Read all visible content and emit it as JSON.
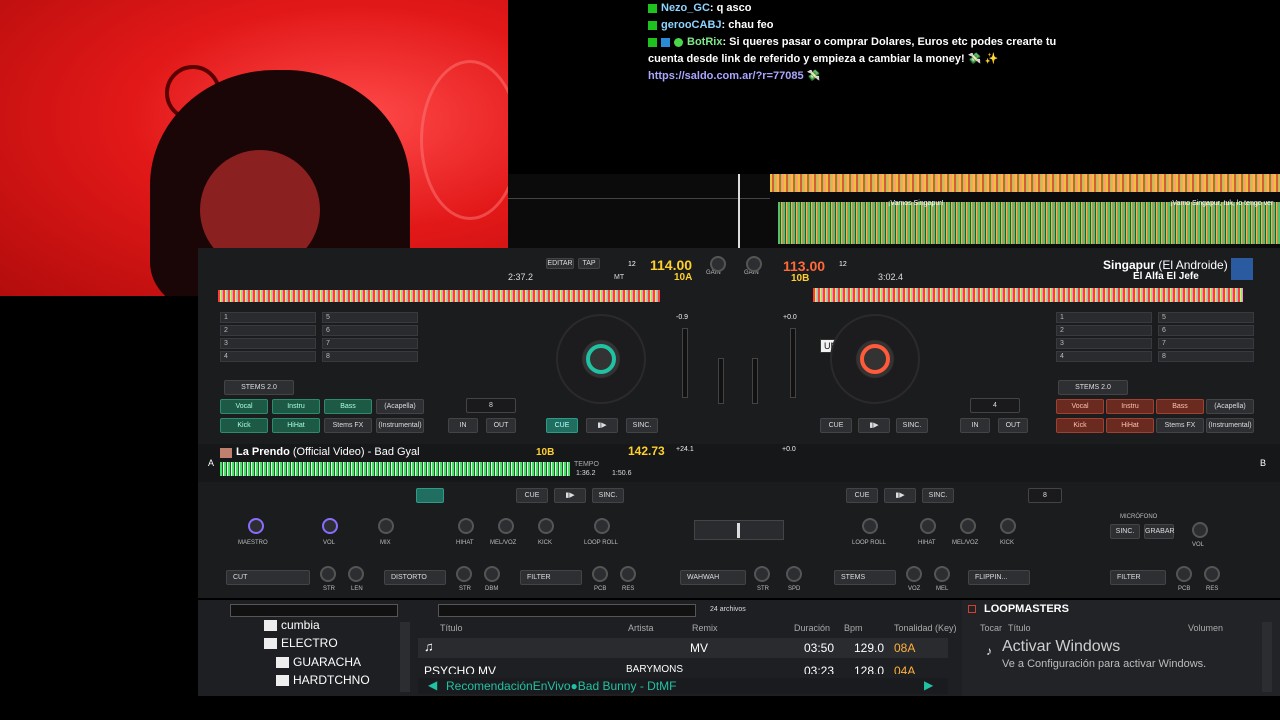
{
  "chat": {
    "lines": [
      {
        "user": "Nezo_GC",
        "text": ": q asco"
      },
      {
        "user": "gerooCABJ",
        "text": ": chau feo"
      },
      {
        "user": "BotRix",
        "text": ": Si queres pasar o comprar Dolares, Euros etc podes crearte tu",
        "cont": "cuenta desde link de referido y empieza a cambiar la money! 💸 ✨"
      },
      {
        "link": "https://saldo.com.ar/?r=77085 💸"
      }
    ]
  },
  "waveform": {
    "label_left": "¡Vamos Singapur!",
    "label_right": "¡Vamo Singapur, tuk, lo tengo ver"
  },
  "deck_left": {
    "time": "2:37.2",
    "bpm": "114.00",
    "key": "10A",
    "key_label": "MT",
    "pitch_val": "12",
    "btn_edit": "EDITAR",
    "btn_tap": "TAP",
    "pitch_display": "-0.9",
    "cue": "CUE",
    "play": "▮▶",
    "sync": "SINC.",
    "stems": "STEMS 2.0",
    "stem_buttons": [
      "Vocal",
      "Instru",
      "Bass",
      "(Acapella)",
      "Kick",
      "HiHat",
      "Stems FX",
      "(Instrumental)"
    ],
    "loop_size": "8",
    "loop_in": "IN",
    "loop_out": "OUT",
    "cue_slots": [
      "1",
      "2",
      "3",
      "4",
      "5",
      "6",
      "7",
      "8"
    ]
  },
  "deck_right": {
    "bpm": "113.00",
    "key": "10B",
    "pitch_val": "12",
    "time": "3:02.4",
    "title": "Singapur",
    "title_suffix": " (El Androide)",
    "artist": "El Alfa El Jefe",
    "pitch_display": "+0.0",
    "tooltip": "UNLOAD",
    "cue": "CUE",
    "play": "▮▶",
    "sync": "SINC.",
    "stems": "STEMS 2.0",
    "stem_buttons": [
      "Vocal",
      "Instru",
      "Bass",
      "(Acapella)",
      "Kick",
      "HiHat",
      "Stems FX",
      "(Instrumental)"
    ],
    "loop_size": "4",
    "loop_in": "IN",
    "loop_out": "OUT",
    "cue_slots": [
      "1",
      "2",
      "3",
      "4",
      "5",
      "6",
      "7",
      "8"
    ]
  },
  "deck_a": {
    "letter": "A",
    "title": "La Prendo",
    "title_suffix": " (Official Video) - Bad Gyal",
    "key": "10B",
    "bpm": "142.73",
    "tempo_label": "TEMPO",
    "time1": "1:36.2",
    "time2": "1:50.6",
    "pitch": "+24.1",
    "cue": "CUE",
    "play": "▮▶",
    "sync": "SINC."
  },
  "deck_b": {
    "letter": "B",
    "pitch": "+0.0",
    "cue": "CUE",
    "play": "▮▶",
    "sync": "SINC.",
    "loop_size": "8"
  },
  "mixer": {
    "gain": "GAIN",
    "labels_left": [
      "MAESTRO",
      "VOL",
      "MIX",
      "HIHAT",
      "MEL/VOZ",
      "KICK",
      "LOOP ROLL"
    ],
    "labels_right": [
      "LOOP ROLL",
      "HIHAT",
      "MEL/VOZ",
      "KICK"
    ],
    "microfono": "MICRÓFONO",
    "mic_btn1": "SINC.",
    "mic_btn2": "GRABAR",
    "mic_vol": "VOL",
    "fx_left": [
      "CUT",
      "DISTORTO",
      "FILTER"
    ],
    "fx_knobs_left": [
      "STR",
      "LEN",
      "STR",
      "DBM",
      "PCB",
      "RES"
    ],
    "fx_center": "WAHWAH",
    "fx_center_knobs": [
      "STR",
      "SPD"
    ],
    "fx_right": [
      "STEMS",
      "FLIPPIN...",
      "FILTER"
    ],
    "fx_knobs_right": [
      "VOZ",
      "MEL",
      "PCB",
      "RES"
    ]
  },
  "browser": {
    "tree": [
      "cumbia",
      "ELECTRO",
      "GUARACHA",
      "HARDTCHNO"
    ],
    "count": "24 archivos",
    "columns": [
      "Título",
      "Artista",
      "Remix",
      "Duración",
      "Bpm",
      "Tonalidad (Key)"
    ],
    "rows": [
      {
        "title": "",
        "artist": "",
        "remix": "MV",
        "duration": "03:50",
        "bpm": "129.0",
        "key": "08A"
      },
      {
        "title": "PSYCHO MV",
        "artist": "BARYMONS",
        "remix": "",
        "duration": "03:23",
        "bpm": "128.0",
        "key": "04A"
      }
    ],
    "now_playing": "RecomendaciónEnVivo●Bad Bunny - DtMF",
    "side_title": "LOOPMASTERS",
    "side_cols": [
      "Tocar",
      "Título",
      "Volumen"
    ],
    "activate_title": "Activar Windows",
    "activate_sub": "Ve a Configuración para activar Windows."
  },
  "colors": {
    "accent": "#21c1a3",
    "bpm": "#ffcf2e",
    "red": "#ff5a3a"
  }
}
